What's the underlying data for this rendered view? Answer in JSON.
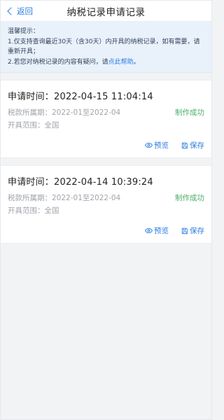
{
  "navbar": {
    "back_label": "返回",
    "title": "纳税记录申请记录"
  },
  "tip": {
    "heading": "温馨提示：",
    "line1": "1.仅支持查询最近30天（含30天）内开具的纳税记录，如有需要，请重新开具；",
    "line2_prefix": "2.若您对纳税记录的内容有疑问，请",
    "line2_link": "点此帮助",
    "line2_suffix": "。"
  },
  "records": [
    {
      "time": "申请时间：2022-04-15 11:04:14",
      "period": "税款所属期：2022-01至2022-04",
      "status": "制作成功",
      "scope": "开具范围：全国",
      "preview_label": "预览",
      "save_label": "保存"
    },
    {
      "time": "申请时间：2022-04-14 10:39:24",
      "period": "税款所属期：2022-01至2022-04",
      "status": "制作成功",
      "scope": "开具范围：全国",
      "preview_label": "预览",
      "save_label": "保存"
    }
  ],
  "colors": {
    "accent": "#2a7de1",
    "success": "#4caf6a",
    "tip_bg": "#e9f1fb",
    "page_bg": "#f2f3f5"
  },
  "icons": {
    "back": "chevron-left-icon",
    "preview": "eye-icon",
    "save": "save-icon"
  }
}
